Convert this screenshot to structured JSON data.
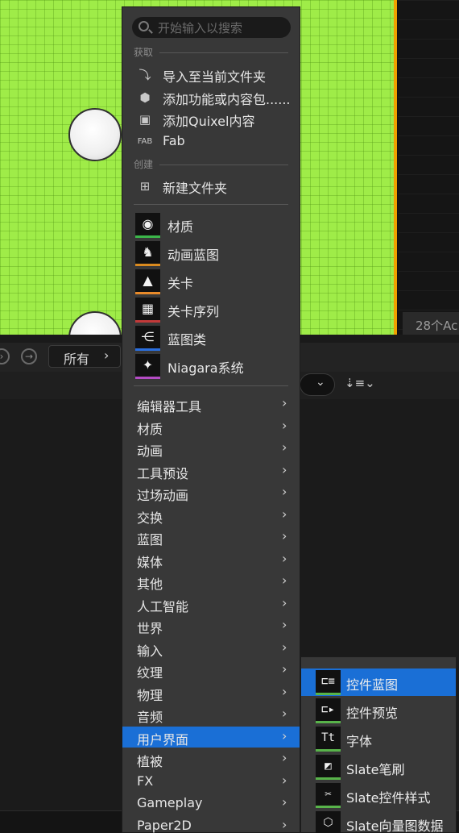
{
  "search": {
    "placeholder": "开始输入以搜索"
  },
  "sections": {
    "get": "获取",
    "create": "创建"
  },
  "get_items": [
    {
      "label": "导入至当前文件夹",
      "icon": "import-icon"
    },
    {
      "label": "添加功能或内容包......",
      "icon": "feature-pack-icon"
    },
    {
      "label": "添加Quixel内容",
      "icon": "quixel-icon"
    },
    {
      "label": "Fab",
      "icon": "fab-icon"
    }
  ],
  "create_items": [
    {
      "label": "新建文件夹",
      "icon": "new-folder-icon"
    }
  ],
  "assets": [
    {
      "label": "材质",
      "icon": "material-icon",
      "color": "#3cb64a"
    },
    {
      "label": "动画蓝图",
      "icon": "animation-blueprint-icon",
      "color": "#d98a1f"
    },
    {
      "label": "关卡",
      "icon": "level-icon",
      "color": "#e88a2a"
    },
    {
      "label": "关卡序列",
      "icon": "level-sequence-icon",
      "color": "#c23a3a"
    },
    {
      "label": "蓝图类",
      "icon": "blueprint-class-icon",
      "color": "#2a6fe0"
    },
    {
      "label": "Niagara系统",
      "icon": "niagara-system-icon",
      "color": "#b44cc4"
    }
  ],
  "categories": [
    "编辑器工具",
    "材质",
    "动画",
    "工具预设",
    "过场动画",
    "交换",
    "蓝图",
    "媒体",
    "其他",
    "人工智能",
    "世界",
    "输入",
    "纹理",
    "物理",
    "音频",
    "用户界面",
    "植被",
    "FX",
    "Gameplay",
    "Paper2D"
  ],
  "active_category": "用户界面",
  "submenu": [
    {
      "label": "控件蓝图",
      "icon": "widget-blueprint-icon"
    },
    {
      "label": "控件预览",
      "icon": "widget-preview-icon"
    },
    {
      "label": "字体",
      "icon": "font-icon"
    },
    {
      "label": "Slate笔刷",
      "icon": "slate-brush-icon"
    },
    {
      "label": "Slate控件样式",
      "icon": "slate-widget-style-icon"
    },
    {
      "label": "Slate向量图数据",
      "icon": "slate-vector-data-icon"
    }
  ],
  "breadcrumb": {
    "label": "所有"
  },
  "actor_count": "28个Ac",
  "colors": {
    "accent": "#1a6fd6",
    "viewport": "#9fec48",
    "selection_border": "#f0a000"
  }
}
